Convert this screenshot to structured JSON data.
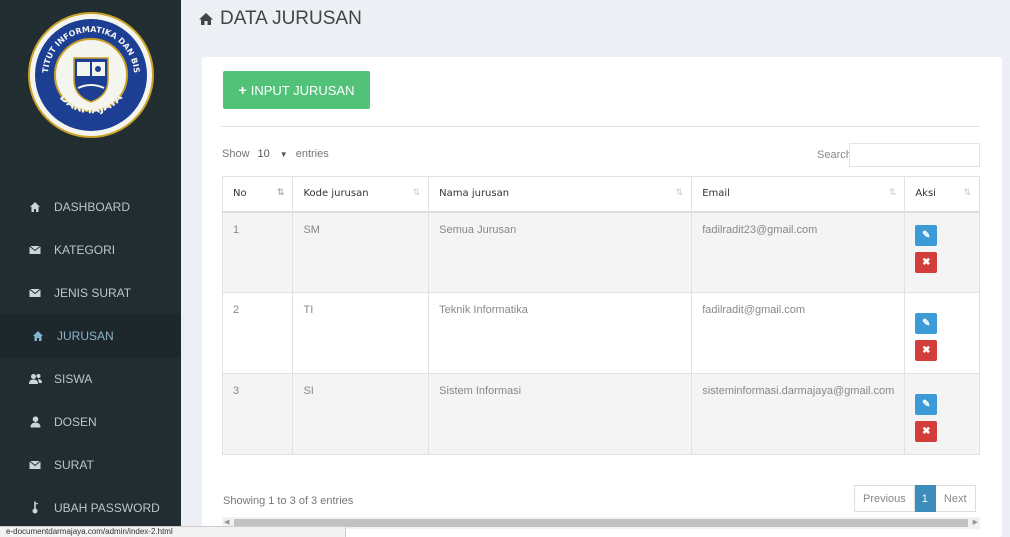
{
  "sidebar": {
    "logo_text_top": "INSTITUT INFORMATIKA DAN BISNIS",
    "logo_text_bottom": "DARMAJAYA",
    "items": [
      {
        "label": "DASHBOARD",
        "icon": "home-icon",
        "active": false
      },
      {
        "label": "KATEGORI",
        "icon": "envelope-icon",
        "active": false
      },
      {
        "label": "JENIS SURAT",
        "icon": "envelope-icon",
        "active": false
      },
      {
        "label": "JURUSAN",
        "icon": "home-icon",
        "active": true
      },
      {
        "label": "SISWA",
        "icon": "users-icon",
        "active": false
      },
      {
        "label": "DOSEN",
        "icon": "user-icon",
        "active": false
      },
      {
        "label": "SURAT",
        "icon": "envelope-icon",
        "active": false
      },
      {
        "label": "UBAH PASSWORD",
        "icon": "key-icon",
        "active": false
      }
    ]
  },
  "header": {
    "title": "DATA JURUSAN"
  },
  "main": {
    "input_button": "INPUT JURUSAN",
    "show_label": "Show",
    "entries_value": "10",
    "entries_label": "entries",
    "search_label": "Search:",
    "search_value": "",
    "columns": [
      "No",
      "Kode jurusan",
      "Nama jurusan",
      "Email",
      "Aksi"
    ],
    "rows": [
      {
        "no": "1",
        "kode": "SM",
        "nama": "Semua Jurusan",
        "email": "fadilradit23@gmail.com"
      },
      {
        "no": "2",
        "kode": "TI",
        "nama": "Teknik Informatika",
        "email": "fadilradit@gmail.com"
      },
      {
        "no": "3",
        "kode": "SI",
        "nama": "Sistem Informasi",
        "email": "sisteminformasi.darmajaya@gmail.com"
      }
    ],
    "info": "Showing 1 to 3 of 3 entries",
    "pagination": {
      "previous": "Previous",
      "current": "1",
      "next": "Next"
    }
  },
  "status_url": "e-documentdarmajaya.com/admin/index-2.html",
  "colors": {
    "sidebar": "#222d32",
    "accent_green": "#52c279",
    "edit_blue": "#3c9bd6",
    "delete_red": "#d33d3a",
    "page_active": "#3c8dbc"
  }
}
